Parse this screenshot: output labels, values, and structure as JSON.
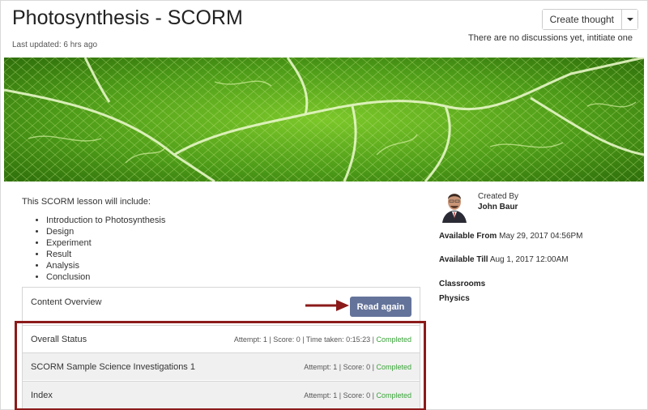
{
  "header": {
    "title": "Photosynthesis - SCORM",
    "last_updated": "Last updated: 6 hrs ago",
    "create_thought_label": "Create thought",
    "no_discussions": "There are no discussions yet, intitiate one"
  },
  "lesson": {
    "intro": "This SCORM lesson will include:",
    "topics": [
      "Introduction to Photosynthesis",
      "Design",
      "Experiment",
      "Result",
      "Analysis",
      "Conclusion"
    ]
  },
  "content_overview": {
    "title": "Content Overview",
    "read_again_label": "Read again",
    "rows": [
      {
        "label": "Overall Status",
        "meta": "Attempt: 1 | Score: 0 | Time taken: 0:15:23 | ",
        "status": "Completed"
      },
      {
        "label": "SCORM Sample Science Investigations 1",
        "meta": "Attempt: 1 | Score: 0 | ",
        "status": "Completed"
      },
      {
        "label": "Index",
        "meta": "Attempt: 1 | Score: 0 | ",
        "status": "Completed"
      }
    ]
  },
  "sidebar": {
    "created_by_label": "Created By",
    "author": "John Baur",
    "available_from_label": "Available From",
    "available_from": "May 29, 2017 04:56PM",
    "available_till_label": "Available Till",
    "available_till": "Aug 1, 2017 12:00AM",
    "classrooms_label": "Classrooms",
    "classroom": "Physics"
  },
  "colors": {
    "accent_button": "#64739a",
    "completed": "#3aa33a",
    "highlight_border": "#8b1a1a"
  }
}
